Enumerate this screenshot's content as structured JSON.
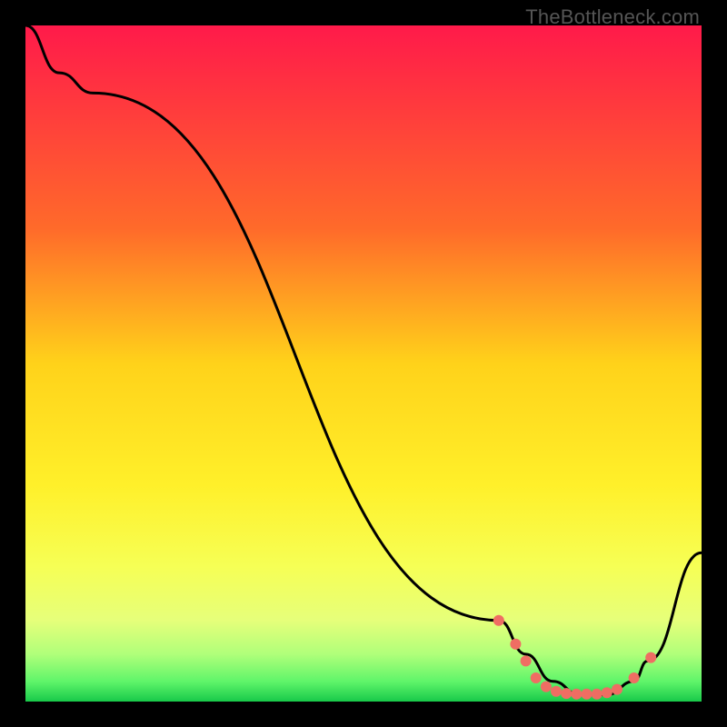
{
  "watermark": "TheBottleneck.com",
  "chart_data": {
    "type": "line",
    "title": "",
    "xlabel": "",
    "ylabel": "",
    "xlim": [
      0,
      100
    ],
    "ylim": [
      0,
      100
    ],
    "gradient_stops": [
      {
        "offset": 0,
        "color": "#ff1a4a"
      },
      {
        "offset": 30,
        "color": "#ff6a2a"
      },
      {
        "offset": 50,
        "color": "#ffd21a"
      },
      {
        "offset": 68,
        "color": "#fff02a"
      },
      {
        "offset": 80,
        "color": "#f6ff55"
      },
      {
        "offset": 88,
        "color": "#e6ff7a"
      },
      {
        "offset": 93,
        "color": "#b0ff7a"
      },
      {
        "offset": 97,
        "color": "#60f56a"
      },
      {
        "offset": 100,
        "color": "#18c94a"
      }
    ],
    "series": [
      {
        "name": "curve",
        "x": [
          0,
          5,
          10,
          70,
          74,
          78,
          82,
          86,
          90,
          92,
          100
        ],
        "y": [
          100,
          93,
          90,
          12,
          7,
          3,
          1,
          1,
          3,
          6,
          22
        ]
      }
    ],
    "markers": {
      "name": "dots",
      "color": "#ef6d63",
      "radius": 6,
      "points": [
        {
          "x": 70.0,
          "y": 12.0
        },
        {
          "x": 72.5,
          "y": 8.5
        },
        {
          "x": 74.0,
          "y": 6.0
        },
        {
          "x": 75.5,
          "y": 3.5
        },
        {
          "x": 77.0,
          "y": 2.2
        },
        {
          "x": 78.5,
          "y": 1.5
        },
        {
          "x": 80.0,
          "y": 1.2
        },
        {
          "x": 81.5,
          "y": 1.1
        },
        {
          "x": 83.0,
          "y": 1.1
        },
        {
          "x": 84.5,
          "y": 1.1
        },
        {
          "x": 86.0,
          "y": 1.3
        },
        {
          "x": 87.5,
          "y": 1.8
        },
        {
          "x": 90.0,
          "y": 3.5
        },
        {
          "x": 92.5,
          "y": 6.5
        }
      ]
    }
  }
}
